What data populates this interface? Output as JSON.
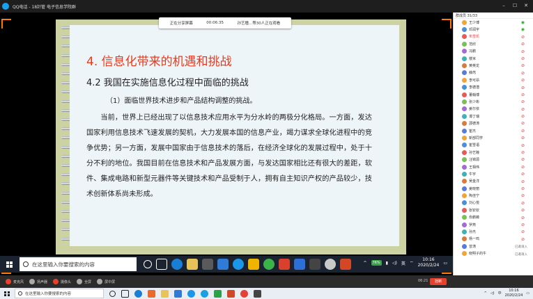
{
  "window": {
    "title": "QQ电话 - 18計管 电子信息学院群"
  },
  "share_banner": {
    "status": "正在分享屏幕",
    "timer": "00:06:35",
    "watchers": "孙艺瞳...等30人正在观看"
  },
  "slide": {
    "heading": "4. 信息化带来的机遇和挑战",
    "subheading": "4.2  我国在实施信息化过程中面临的挑战",
    "point": "（1）面临世界技术进步和产品结构调整的挑战。",
    "paragraph": "当前，世界上已经出现了以信息技术应用水平为分水岭的两极分化格局。一方面，发达国家利用信息技术飞速发展的契机，大力发展本国的信息产业，竭力谋求全球化进程中的竞争优势；另一方面，发展中国家由于信息技术的落后，在经济全球化的发展过程中，处于十分不利的地位。我国目前在信息技术和产品发展方面，与发达国家相比还有很大的差距，软件、集成电路和新型元器件等关键技术和产品受制于人，拥有自主知识产权的产品较少，技术创新体系尚未形成。"
  },
  "inner_taskbar": {
    "search_placeholder": "在这里输入你要搜索的内容",
    "battery": "76%",
    "ime": "英",
    "time": "10:16",
    "date": "2020/2/24"
  },
  "panel": {
    "header": "群成员 31/33",
    "members": [
      {
        "name": "王少博",
        "status": "mic-on"
      },
      {
        "name": "邓润宇",
        "status": "mic-on"
      },
      {
        "name": "朱雪凯",
        "status": "host"
      },
      {
        "name": "范欣",
        "status": "muted"
      },
      {
        "name": "冯鹏",
        "status": "muted"
      },
      {
        "name": "楼米",
        "status": "muted"
      },
      {
        "name": "黄英龙",
        "status": "muted"
      },
      {
        "name": "薛芮",
        "status": "muted"
      },
      {
        "name": "李可昂",
        "status": "muted"
      },
      {
        "name": "李德潜",
        "status": "muted"
      },
      {
        "name": "董翰博",
        "status": "muted"
      },
      {
        "name": "张少彬",
        "status": "muted"
      },
      {
        "name": "姜尔依",
        "status": "muted"
      },
      {
        "name": "谭丁瑞",
        "status": "muted"
      },
      {
        "name": "邵德涛",
        "status": "muted"
      },
      {
        "name": "崔杰",
        "status": "muted"
      },
      {
        "name": "新部同学",
        "status": "muted"
      },
      {
        "name": "崔雪语",
        "status": "muted"
      },
      {
        "name": "孙艺瞳",
        "status": "muted"
      },
      {
        "name": "汪锦源",
        "status": "muted"
      },
      {
        "name": "王相伟",
        "status": "muted"
      },
      {
        "name": "牛宇",
        "status": "muted"
      },
      {
        "name": "吴金洋",
        "status": "muted"
      },
      {
        "name": "姜晓丽",
        "status": "muted"
      },
      {
        "name": "陶佳宁",
        "status": "muted"
      },
      {
        "name": "刘心悦",
        "status": "muted"
      },
      {
        "name": "张钦钦",
        "status": "muted"
      },
      {
        "name": "俞鹏薇",
        "status": "muted"
      },
      {
        "name": "罗燕",
        "status": "muted"
      },
      {
        "name": "孙杰",
        "status": "muted"
      },
      {
        "name": "杨一鸣",
        "status": "muted"
      },
      {
        "name": "曾涛",
        "status": "text",
        "text": "已邀请入"
      },
      {
        "name": "晓明子的牛",
        "status": "text",
        "text": "已邀请入"
      }
    ]
  },
  "callbar": {
    "items": [
      "麦克风",
      "扬声器",
      "摄像头",
      "全屏",
      "屏中屏"
    ],
    "elapsed": "06:21",
    "hangup": "挂断"
  },
  "outer_taskbar": {
    "search_placeholder": "在这里输入你要搜索的内容",
    "ime": "中",
    "time": "10:16",
    "date": "2020/2/24"
  },
  "colors": {
    "heading_red": "#e53a1e",
    "slide_border": "#ccd2a2",
    "slide_page": "#eef5f8",
    "share_corner": "#ff7a00",
    "hangup_red": "#e8402c"
  }
}
